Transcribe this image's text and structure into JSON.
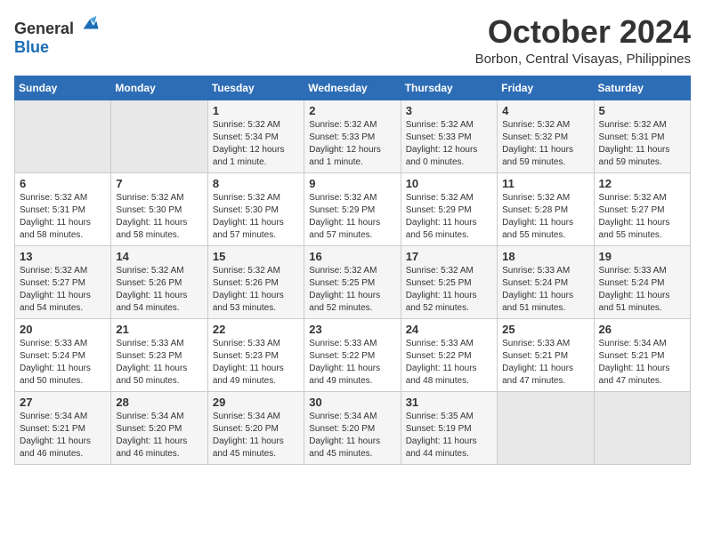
{
  "header": {
    "logo_general": "General",
    "logo_blue": "Blue",
    "month": "October 2024",
    "location": "Borbon, Central Visayas, Philippines"
  },
  "days_of_week": [
    "Sunday",
    "Monday",
    "Tuesday",
    "Wednesday",
    "Thursday",
    "Friday",
    "Saturday"
  ],
  "weeks": [
    [
      {
        "day": "",
        "info": ""
      },
      {
        "day": "",
        "info": ""
      },
      {
        "day": "1",
        "info": "Sunrise: 5:32 AM\nSunset: 5:34 PM\nDaylight: 12 hours\nand 1 minute."
      },
      {
        "day": "2",
        "info": "Sunrise: 5:32 AM\nSunset: 5:33 PM\nDaylight: 12 hours\nand 1 minute."
      },
      {
        "day": "3",
        "info": "Sunrise: 5:32 AM\nSunset: 5:33 PM\nDaylight: 12 hours\nand 0 minutes."
      },
      {
        "day": "4",
        "info": "Sunrise: 5:32 AM\nSunset: 5:32 PM\nDaylight: 11 hours\nand 59 minutes."
      },
      {
        "day": "5",
        "info": "Sunrise: 5:32 AM\nSunset: 5:31 PM\nDaylight: 11 hours\nand 59 minutes."
      }
    ],
    [
      {
        "day": "6",
        "info": "Sunrise: 5:32 AM\nSunset: 5:31 PM\nDaylight: 11 hours\nand 58 minutes."
      },
      {
        "day": "7",
        "info": "Sunrise: 5:32 AM\nSunset: 5:30 PM\nDaylight: 11 hours\nand 58 minutes."
      },
      {
        "day": "8",
        "info": "Sunrise: 5:32 AM\nSunset: 5:30 PM\nDaylight: 11 hours\nand 57 minutes."
      },
      {
        "day": "9",
        "info": "Sunrise: 5:32 AM\nSunset: 5:29 PM\nDaylight: 11 hours\nand 57 minutes."
      },
      {
        "day": "10",
        "info": "Sunrise: 5:32 AM\nSunset: 5:29 PM\nDaylight: 11 hours\nand 56 minutes."
      },
      {
        "day": "11",
        "info": "Sunrise: 5:32 AM\nSunset: 5:28 PM\nDaylight: 11 hours\nand 55 minutes."
      },
      {
        "day": "12",
        "info": "Sunrise: 5:32 AM\nSunset: 5:27 PM\nDaylight: 11 hours\nand 55 minutes."
      }
    ],
    [
      {
        "day": "13",
        "info": "Sunrise: 5:32 AM\nSunset: 5:27 PM\nDaylight: 11 hours\nand 54 minutes."
      },
      {
        "day": "14",
        "info": "Sunrise: 5:32 AM\nSunset: 5:26 PM\nDaylight: 11 hours\nand 54 minutes."
      },
      {
        "day": "15",
        "info": "Sunrise: 5:32 AM\nSunset: 5:26 PM\nDaylight: 11 hours\nand 53 minutes."
      },
      {
        "day": "16",
        "info": "Sunrise: 5:32 AM\nSunset: 5:25 PM\nDaylight: 11 hours\nand 52 minutes."
      },
      {
        "day": "17",
        "info": "Sunrise: 5:32 AM\nSunset: 5:25 PM\nDaylight: 11 hours\nand 52 minutes."
      },
      {
        "day": "18",
        "info": "Sunrise: 5:33 AM\nSunset: 5:24 PM\nDaylight: 11 hours\nand 51 minutes."
      },
      {
        "day": "19",
        "info": "Sunrise: 5:33 AM\nSunset: 5:24 PM\nDaylight: 11 hours\nand 51 minutes."
      }
    ],
    [
      {
        "day": "20",
        "info": "Sunrise: 5:33 AM\nSunset: 5:24 PM\nDaylight: 11 hours\nand 50 minutes."
      },
      {
        "day": "21",
        "info": "Sunrise: 5:33 AM\nSunset: 5:23 PM\nDaylight: 11 hours\nand 50 minutes."
      },
      {
        "day": "22",
        "info": "Sunrise: 5:33 AM\nSunset: 5:23 PM\nDaylight: 11 hours\nand 49 minutes."
      },
      {
        "day": "23",
        "info": "Sunrise: 5:33 AM\nSunset: 5:22 PM\nDaylight: 11 hours\nand 49 minutes."
      },
      {
        "day": "24",
        "info": "Sunrise: 5:33 AM\nSunset: 5:22 PM\nDaylight: 11 hours\nand 48 minutes."
      },
      {
        "day": "25",
        "info": "Sunrise: 5:33 AM\nSunset: 5:21 PM\nDaylight: 11 hours\nand 47 minutes."
      },
      {
        "day": "26",
        "info": "Sunrise: 5:34 AM\nSunset: 5:21 PM\nDaylight: 11 hours\nand 47 minutes."
      }
    ],
    [
      {
        "day": "27",
        "info": "Sunrise: 5:34 AM\nSunset: 5:21 PM\nDaylight: 11 hours\nand 46 minutes."
      },
      {
        "day": "28",
        "info": "Sunrise: 5:34 AM\nSunset: 5:20 PM\nDaylight: 11 hours\nand 46 minutes."
      },
      {
        "day": "29",
        "info": "Sunrise: 5:34 AM\nSunset: 5:20 PM\nDaylight: 11 hours\nand 45 minutes."
      },
      {
        "day": "30",
        "info": "Sunrise: 5:34 AM\nSunset: 5:20 PM\nDaylight: 11 hours\nand 45 minutes."
      },
      {
        "day": "31",
        "info": "Sunrise: 5:35 AM\nSunset: 5:19 PM\nDaylight: 11 hours\nand 44 minutes."
      },
      {
        "day": "",
        "info": ""
      },
      {
        "day": "",
        "info": ""
      }
    ]
  ]
}
